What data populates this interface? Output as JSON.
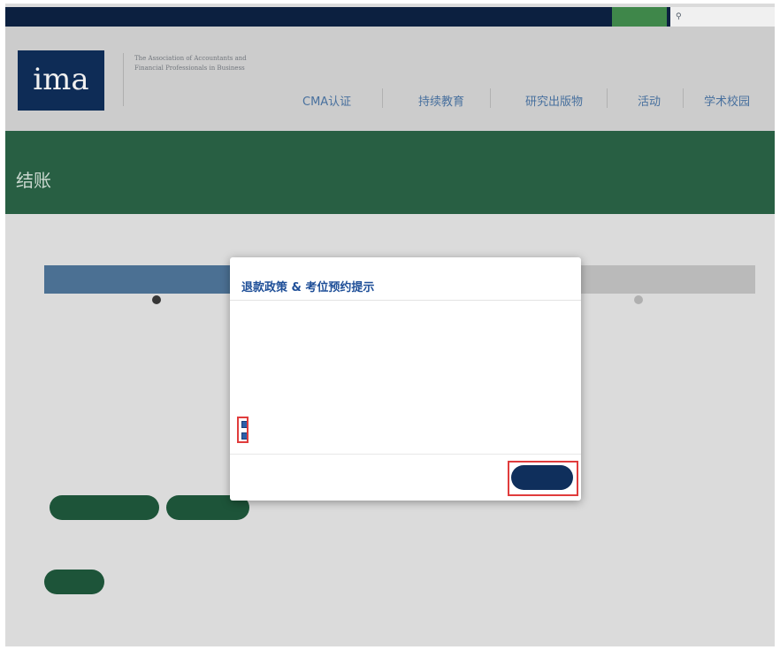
{
  "util_bar": {
    "site_note": "",
    "links": [
      "",
      "",
      "",
      "",
      ""
    ],
    "join_label": "",
    "search_placeholder": ""
  },
  "header": {
    "logo_text": "ima",
    "association_name": "The Association of Accountants and Financial Professionals in Business",
    "nav": [
      "CMA认证",
      "持续教育",
      "研究出版物",
      "活动",
      "学术校园"
    ]
  },
  "page": {
    "title": "结账"
  },
  "steps": {
    "active_label": "",
    "last_label": ""
  },
  "section": {
    "title": "",
    "text": ""
  },
  "buttons": {
    "primary_pill_1": "",
    "primary_pill_2": "",
    "small_pill": "",
    "pay_link": ""
  },
  "modal": {
    "title": "退款政策 & 考位预约提示",
    "para1": "",
    "para2": "",
    "agree_1": "",
    "agree_2": "",
    "agree_button": ""
  },
  "colors": {
    "navy": "#0f2f5c",
    "green": "#2b6548",
    "steps_active": "#50779d",
    "highlight_red": "#e03c3c",
    "nav_link": "#4d78a8"
  }
}
